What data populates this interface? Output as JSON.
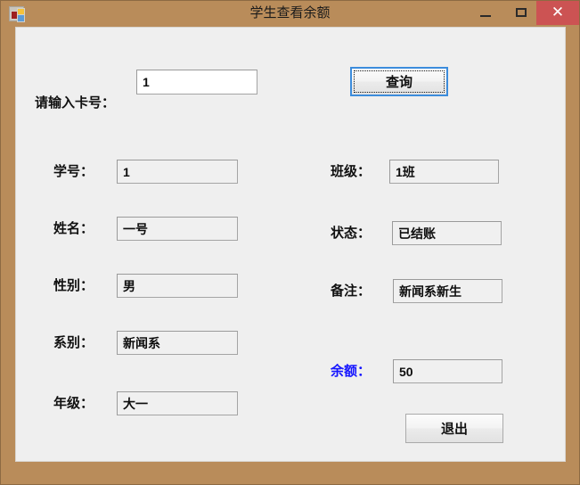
{
  "window": {
    "title": "学生查看余额",
    "icon": "app-icon",
    "controls": {
      "minimize": "–",
      "maximize": "□",
      "close": "✕"
    },
    "colors": {
      "titlebar": "#b98c5a",
      "client": "#efefef",
      "close_button": "#cc5353",
      "accent_label": "#1414ff",
      "focus_border": "#3c8cdc"
    }
  },
  "search": {
    "label": "请输入卡号：",
    "value": "1",
    "placeholder": "",
    "button_label": "查询"
  },
  "fields": {
    "left": [
      {
        "label": "学号：",
        "value": "1"
      },
      {
        "label": "姓名：",
        "value": "一号"
      },
      {
        "label": "性别：",
        "value": "男"
      },
      {
        "label": "系别：",
        "value": "新闻系"
      },
      {
        "label": "年级：",
        "value": "大一"
      }
    ],
    "right": [
      {
        "label": "班级：",
        "value": "1班"
      },
      {
        "label": "状态：",
        "value": "已结账"
      },
      {
        "label": "备注：",
        "value": "新闻系新生"
      },
      {
        "label": "余额：",
        "value": "50"
      }
    ]
  },
  "actions": {
    "exit_label": "退出"
  }
}
